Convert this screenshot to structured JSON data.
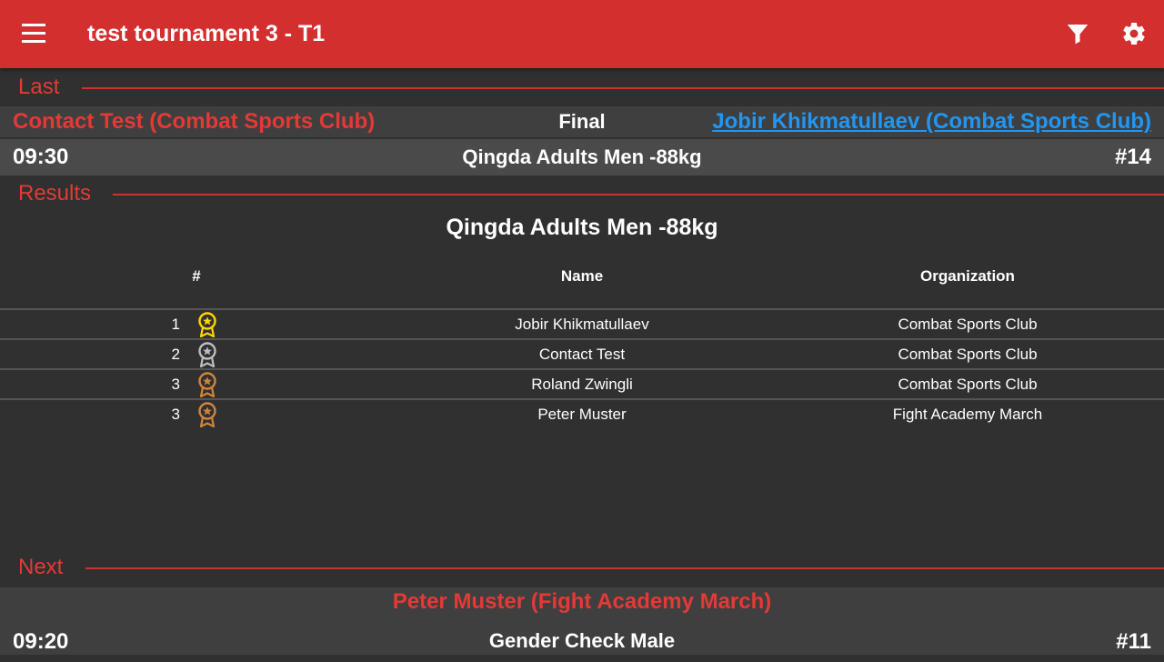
{
  "app_bar": {
    "title": "test tournament 3 - T1",
    "menu_icon": "menu-icon",
    "filter_icon": "filter-icon",
    "settings_icon": "settings-icon",
    "background": "#d32f2f"
  },
  "last": {
    "label": "Last",
    "red_competitor": "Contact  Test (Combat Sports Club)",
    "round": "Final",
    "blue_competitor": "Jobir Khikmatullaev (Combat Sports Club)",
    "time": "09:30",
    "category": "Qingda Adults Men -88kg",
    "fight_number": "#14"
  },
  "results": {
    "label": "Results",
    "category_title": "Qingda Adults Men -88kg",
    "columns": {
      "rank": "#",
      "name": "Name",
      "organization": "Organization"
    },
    "rows": [
      {
        "rank": "1",
        "medal": "gold",
        "name": "Jobir Khikmatullaev",
        "organization": "Combat Sports Club"
      },
      {
        "rank": "2",
        "medal": "silver",
        "name": "Contact  Test",
        "organization": "Combat Sports Club"
      },
      {
        "rank": "3",
        "medal": "bronze",
        "name": "Roland Zwingli",
        "organization": "Combat Sports Club"
      },
      {
        "rank": "3",
        "medal": "bronze",
        "name": "Peter Muster",
        "organization": "Fight Academy March"
      }
    ],
    "medal_colors": {
      "gold": "#ffd600",
      "silver": "#bdbdbd",
      "bronze": "#cd853f"
    }
  },
  "next": {
    "label": "Next",
    "red_competitor": "Peter Muster (Fight Academy March)",
    "time": "09:20",
    "category": "Gender Check Male",
    "fight_number": "#11"
  },
  "colors": {
    "accent_red": "#e53935",
    "link_blue": "#2196f3",
    "background": "#303030"
  }
}
